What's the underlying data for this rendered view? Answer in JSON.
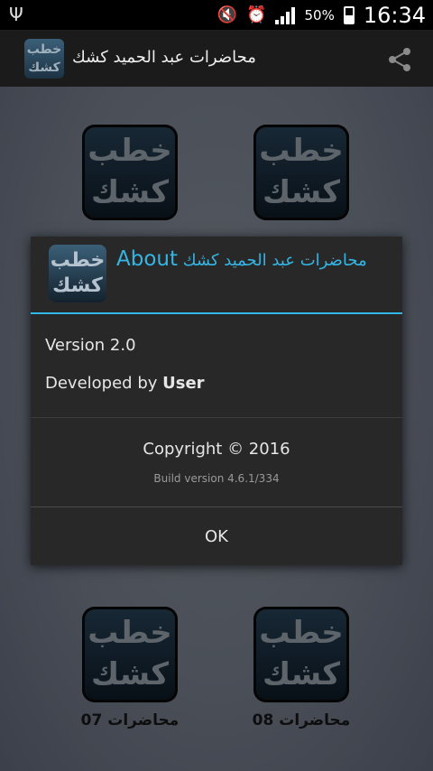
{
  "status_bar": {
    "usb_icon": "usb-icon",
    "battery_percent": "50%",
    "time": "16:34"
  },
  "action_bar": {
    "app_icon_text": "خطب كشك",
    "title": "محاضرات عبد الحميد كشك",
    "share_icon": "share-icon"
  },
  "tiles": [
    {
      "icon_text": "خطب كشك",
      "caption": ""
    },
    {
      "icon_text": "خطب كشك",
      "caption": ""
    },
    {
      "icon_text": "خطب كشك",
      "caption": "محاضرات 07"
    },
    {
      "icon_text": "خطب كشك",
      "caption": "محاضرات 08"
    }
  ],
  "dialog": {
    "icon_text": "خطب كشك",
    "title_en": "About",
    "title_ar": "محاضرات عبد الحميد كشك",
    "version": "Version 2.0",
    "developed_prefix": "Developed by",
    "developer": "User",
    "copyright": "Copyright © 2016",
    "build": "Build version 4.6.1/334",
    "ok_label": "OK"
  },
  "colors": {
    "accent": "#33b5e5",
    "dialog_bg": "#282828",
    "actionbar_bg": "#1b1b1b"
  }
}
